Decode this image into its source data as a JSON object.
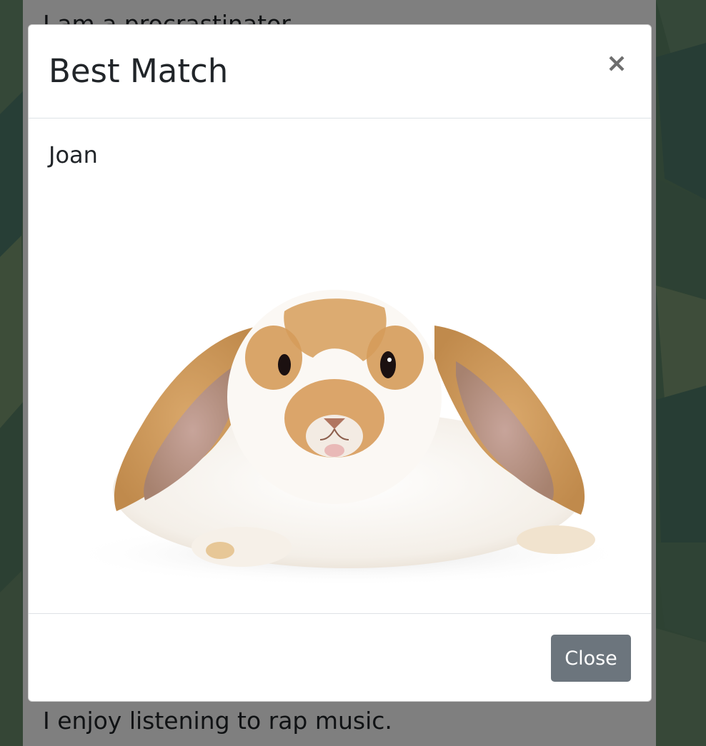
{
  "background": {
    "text_top": "I am a procrastinator.",
    "text_bottom": "I enjoy listening to rap music."
  },
  "modal": {
    "title": "Best Match",
    "close_icon": "close-icon",
    "match_name": "Joan",
    "image_subject": "bunny-photo",
    "footer": {
      "close_label": "Close"
    }
  },
  "colors": {
    "secondary_button": "#6c757d",
    "text": "#212529",
    "divider": "#dee2e6",
    "background_green": "#5d8466"
  }
}
